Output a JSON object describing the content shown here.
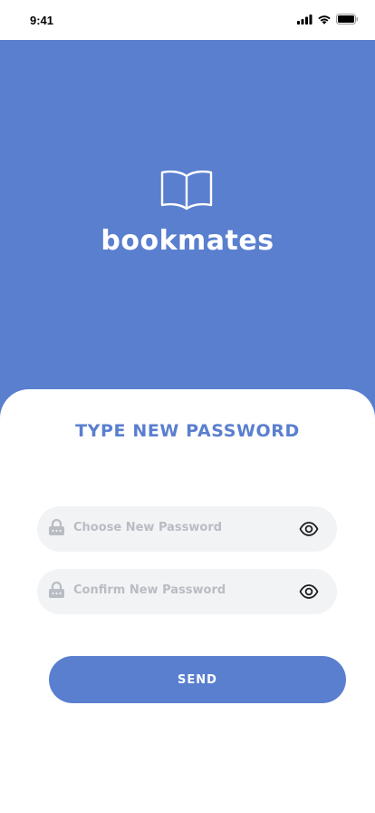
{
  "status_bar": {
    "time": "9:41",
    "icons": [
      "signal-icon",
      "wifi-icon",
      "battery-icon"
    ]
  },
  "hero": {
    "logo_icon": "open-book-icon",
    "brand_name": "bookmates",
    "background_color": "#5a7fcf"
  },
  "form": {
    "title": "TYPE NEW PASSWORD",
    "fields": [
      {
        "placeholder": "Choose New Password",
        "icon": "lock-icon",
        "toggle_icon": "eye-icon"
      },
      {
        "placeholder": "Confirm New Password",
        "icon": "lock-icon",
        "toggle_icon": "eye-icon"
      }
    ],
    "submit_label": "SEND"
  },
  "colors": {
    "accent": "#5a7fcf",
    "field_background": "#f2f3f5",
    "placeholder": "#b9bcc3"
  }
}
